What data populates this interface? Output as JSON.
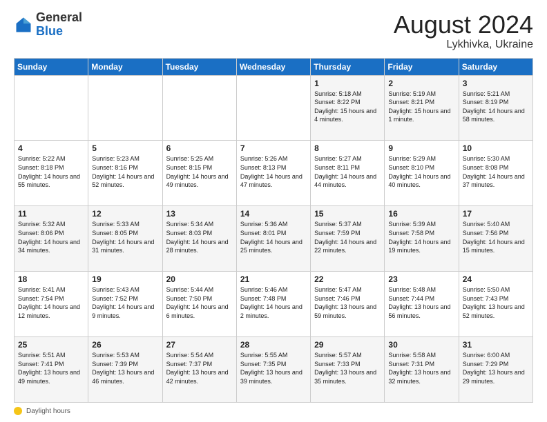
{
  "header": {
    "logo_general": "General",
    "logo_blue": "Blue",
    "month": "August 2024",
    "location": "Lykhivka, Ukraine"
  },
  "weekdays": [
    "Sunday",
    "Monday",
    "Tuesday",
    "Wednesday",
    "Thursday",
    "Friday",
    "Saturday"
  ],
  "weeks": [
    [
      {
        "day": "",
        "info": ""
      },
      {
        "day": "",
        "info": ""
      },
      {
        "day": "",
        "info": ""
      },
      {
        "day": "",
        "info": ""
      },
      {
        "day": "1",
        "info": "Sunrise: 5:18 AM\nSunset: 8:22 PM\nDaylight: 15 hours\nand 4 minutes."
      },
      {
        "day": "2",
        "info": "Sunrise: 5:19 AM\nSunset: 8:21 PM\nDaylight: 15 hours\nand 1 minute."
      },
      {
        "day": "3",
        "info": "Sunrise: 5:21 AM\nSunset: 8:19 PM\nDaylight: 14 hours\nand 58 minutes."
      }
    ],
    [
      {
        "day": "4",
        "info": "Sunrise: 5:22 AM\nSunset: 8:18 PM\nDaylight: 14 hours\nand 55 minutes."
      },
      {
        "day": "5",
        "info": "Sunrise: 5:23 AM\nSunset: 8:16 PM\nDaylight: 14 hours\nand 52 minutes."
      },
      {
        "day": "6",
        "info": "Sunrise: 5:25 AM\nSunset: 8:15 PM\nDaylight: 14 hours\nand 49 minutes."
      },
      {
        "day": "7",
        "info": "Sunrise: 5:26 AM\nSunset: 8:13 PM\nDaylight: 14 hours\nand 47 minutes."
      },
      {
        "day": "8",
        "info": "Sunrise: 5:27 AM\nSunset: 8:11 PM\nDaylight: 14 hours\nand 44 minutes."
      },
      {
        "day": "9",
        "info": "Sunrise: 5:29 AM\nSunset: 8:10 PM\nDaylight: 14 hours\nand 40 minutes."
      },
      {
        "day": "10",
        "info": "Sunrise: 5:30 AM\nSunset: 8:08 PM\nDaylight: 14 hours\nand 37 minutes."
      }
    ],
    [
      {
        "day": "11",
        "info": "Sunrise: 5:32 AM\nSunset: 8:06 PM\nDaylight: 14 hours\nand 34 minutes."
      },
      {
        "day": "12",
        "info": "Sunrise: 5:33 AM\nSunset: 8:05 PM\nDaylight: 14 hours\nand 31 minutes."
      },
      {
        "day": "13",
        "info": "Sunrise: 5:34 AM\nSunset: 8:03 PM\nDaylight: 14 hours\nand 28 minutes."
      },
      {
        "day": "14",
        "info": "Sunrise: 5:36 AM\nSunset: 8:01 PM\nDaylight: 14 hours\nand 25 minutes."
      },
      {
        "day": "15",
        "info": "Sunrise: 5:37 AM\nSunset: 7:59 PM\nDaylight: 14 hours\nand 22 minutes."
      },
      {
        "day": "16",
        "info": "Sunrise: 5:39 AM\nSunset: 7:58 PM\nDaylight: 14 hours\nand 19 minutes."
      },
      {
        "day": "17",
        "info": "Sunrise: 5:40 AM\nSunset: 7:56 PM\nDaylight: 14 hours\nand 15 minutes."
      }
    ],
    [
      {
        "day": "18",
        "info": "Sunrise: 5:41 AM\nSunset: 7:54 PM\nDaylight: 14 hours\nand 12 minutes."
      },
      {
        "day": "19",
        "info": "Sunrise: 5:43 AM\nSunset: 7:52 PM\nDaylight: 14 hours\nand 9 minutes."
      },
      {
        "day": "20",
        "info": "Sunrise: 5:44 AM\nSunset: 7:50 PM\nDaylight: 14 hours\nand 6 minutes."
      },
      {
        "day": "21",
        "info": "Sunrise: 5:46 AM\nSunset: 7:48 PM\nDaylight: 14 hours\nand 2 minutes."
      },
      {
        "day": "22",
        "info": "Sunrise: 5:47 AM\nSunset: 7:46 PM\nDaylight: 13 hours\nand 59 minutes."
      },
      {
        "day": "23",
        "info": "Sunrise: 5:48 AM\nSunset: 7:44 PM\nDaylight: 13 hours\nand 56 minutes."
      },
      {
        "day": "24",
        "info": "Sunrise: 5:50 AM\nSunset: 7:43 PM\nDaylight: 13 hours\nand 52 minutes."
      }
    ],
    [
      {
        "day": "25",
        "info": "Sunrise: 5:51 AM\nSunset: 7:41 PM\nDaylight: 13 hours\nand 49 minutes."
      },
      {
        "day": "26",
        "info": "Sunrise: 5:53 AM\nSunset: 7:39 PM\nDaylight: 13 hours\nand 46 minutes."
      },
      {
        "day": "27",
        "info": "Sunrise: 5:54 AM\nSunset: 7:37 PM\nDaylight: 13 hours\nand 42 minutes."
      },
      {
        "day": "28",
        "info": "Sunrise: 5:55 AM\nSunset: 7:35 PM\nDaylight: 13 hours\nand 39 minutes."
      },
      {
        "day": "29",
        "info": "Sunrise: 5:57 AM\nSunset: 7:33 PM\nDaylight: 13 hours\nand 35 minutes."
      },
      {
        "day": "30",
        "info": "Sunrise: 5:58 AM\nSunset: 7:31 PM\nDaylight: 13 hours\nand 32 minutes."
      },
      {
        "day": "31",
        "info": "Sunrise: 6:00 AM\nSunset: 7:29 PM\nDaylight: 13 hours\nand 29 minutes."
      }
    ]
  ],
  "footer": {
    "label": "Daylight hours"
  }
}
